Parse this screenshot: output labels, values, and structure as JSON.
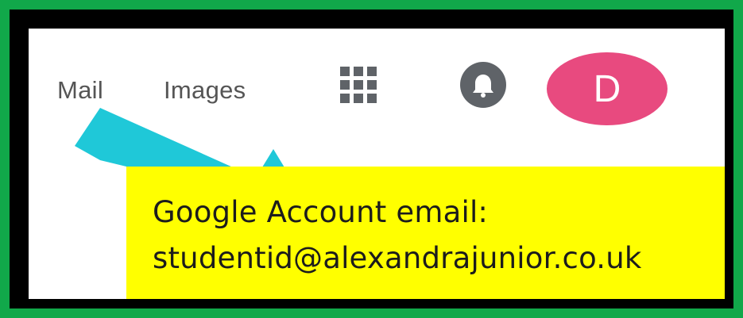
{
  "header": {
    "links": [
      "Mail",
      "Images"
    ],
    "apps_icon": "apps-grid-icon",
    "notifications_icon": "bell-icon",
    "avatar_initial": "D",
    "avatar_color": "#e84a7f"
  },
  "callout": {
    "line1": "Google Account email:",
    "line2": "studentid@alexandrajunior.co.uk",
    "background": "#ffff00"
  },
  "annotation": {
    "arrow_icon": "arrow-icon",
    "arrow_color": "#1fc8d8"
  },
  "frame": {
    "border_color": "#11a84a"
  }
}
